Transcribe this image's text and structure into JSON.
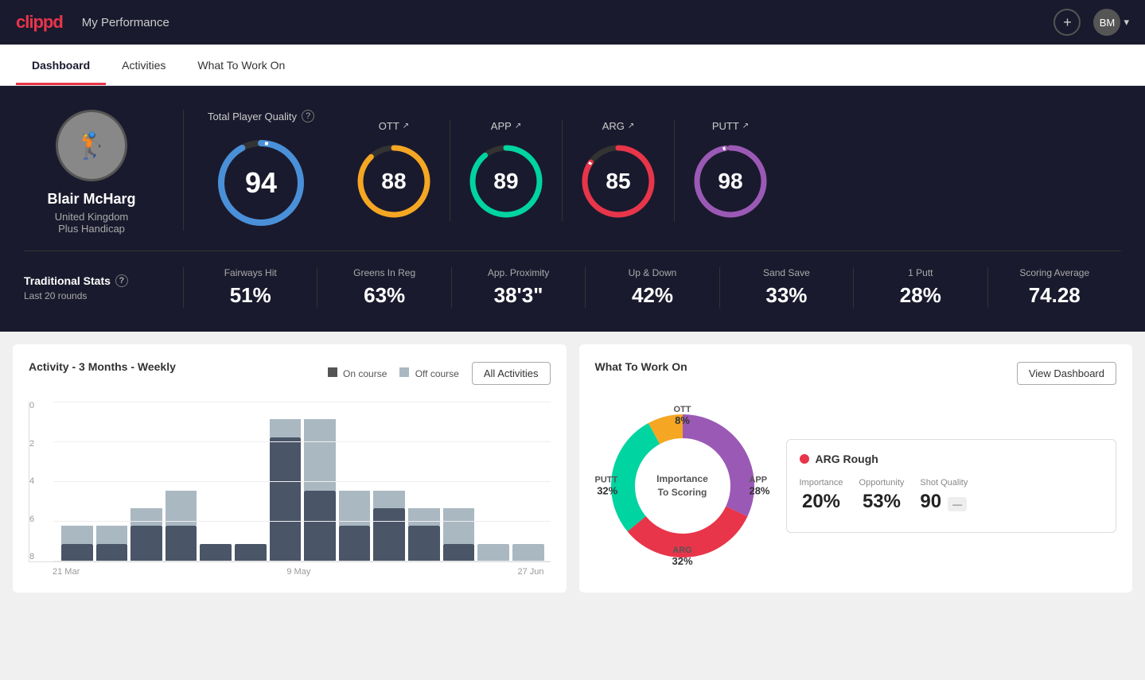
{
  "header": {
    "logo": "clippd",
    "title": "My Performance",
    "add_icon": "+",
    "avatar_text": "BM",
    "dropdown_arrow": "▾"
  },
  "nav": {
    "tabs": [
      {
        "label": "Dashboard",
        "active": true
      },
      {
        "label": "Activities",
        "active": false
      },
      {
        "label": "What To Work On",
        "active": false
      }
    ]
  },
  "player": {
    "name": "Blair McHarg",
    "country": "United Kingdom",
    "handicap": "Plus Handicap"
  },
  "scores": {
    "tpq_label": "Total Player Quality",
    "total": 94,
    "categories": [
      {
        "label": "OTT",
        "value": 88,
        "color": "#f5a623",
        "bg_color": "#333",
        "pct": 88
      },
      {
        "label": "APP",
        "value": 89,
        "color": "#00d4a0",
        "bg_color": "#333",
        "pct": 89
      },
      {
        "label": "ARG",
        "value": 85,
        "color": "#e8354a",
        "bg_color": "#333",
        "pct": 85
      },
      {
        "label": "PUTT",
        "value": 98,
        "color": "#9b59b6",
        "bg_color": "#333",
        "pct": 98
      }
    ]
  },
  "traditional_stats": {
    "title": "Traditional Stats",
    "subtitle": "Last 20 rounds",
    "stats": [
      {
        "label": "Fairways Hit",
        "value": "51%"
      },
      {
        "label": "Greens In Reg",
        "value": "63%"
      },
      {
        "label": "App. Proximity",
        "value": "38'3\""
      },
      {
        "label": "Up & Down",
        "value": "42%"
      },
      {
        "label": "Sand Save",
        "value": "33%"
      },
      {
        "label": "1 Putt",
        "value": "28%"
      },
      {
        "label": "Scoring Average",
        "value": "74.28"
      }
    ]
  },
  "activity_chart": {
    "title": "Activity - 3 Months - Weekly",
    "legend_on_course": "On course",
    "legend_off_course": "Off course",
    "all_activities_btn": "All Activities",
    "y_labels": [
      "0",
      "2",
      "4",
      "6",
      "8"
    ],
    "x_labels": [
      "21 Mar",
      "9 May",
      "27 Jun"
    ],
    "bars": [
      {
        "on": 1,
        "off": 1
      },
      {
        "on": 1,
        "off": 1
      },
      {
        "on": 2,
        "off": 1
      },
      {
        "on": 2,
        "off": 2
      },
      {
        "on": 1,
        "off": 0
      },
      {
        "on": 1,
        "off": 0
      },
      {
        "on": 7,
        "off": 1
      },
      {
        "on": 4,
        "off": 4
      },
      {
        "on": 2,
        "off": 2
      },
      {
        "on": 3,
        "off": 1
      },
      {
        "on": 2,
        "off": 1
      },
      {
        "on": 1,
        "off": 2
      },
      {
        "on": 0,
        "off": 1
      },
      {
        "on": 0,
        "off": 1
      }
    ]
  },
  "what_to_work_on": {
    "title": "What To Work On",
    "view_dashboard_btn": "View Dashboard",
    "center_label_line1": "Importance",
    "center_label_line2": "To Scoring",
    "segments": [
      {
        "label": "OTT",
        "pct": "8%",
        "color": "#f5a623"
      },
      {
        "label": "APP",
        "pct": "28%",
        "color": "#00d4a0"
      },
      {
        "label": "ARG",
        "pct": "32%",
        "color": "#e8354a"
      },
      {
        "label": "PUTT",
        "pct": "32%",
        "color": "#9b59b6"
      }
    ],
    "info_card": {
      "title": "ARG Rough",
      "importance_label": "Importance",
      "importance_value": "20%",
      "opportunity_label": "Opportunity",
      "opportunity_value": "53%",
      "shot_quality_label": "Shot Quality",
      "shot_quality_value": "90",
      "shot_quality_badge": "—"
    }
  }
}
